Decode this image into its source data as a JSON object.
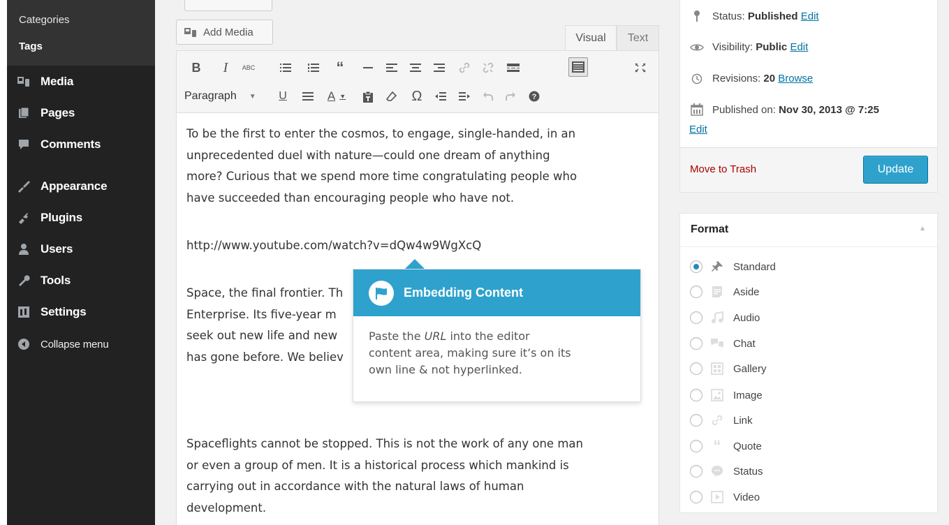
{
  "sidebar": {
    "submenu": [
      "Categories",
      "Tags"
    ],
    "items": [
      {
        "label": "Media",
        "icon": "media-icon"
      },
      {
        "label": "Pages",
        "icon": "pages-icon"
      },
      {
        "label": "Comments",
        "icon": "comments-icon"
      },
      {
        "label": "Appearance",
        "icon": "appearance-icon"
      },
      {
        "label": "Plugins",
        "icon": "plugins-icon"
      },
      {
        "label": "Users",
        "icon": "users-icon"
      },
      {
        "label": "Tools",
        "icon": "tools-icon"
      },
      {
        "label": "Settings",
        "icon": "settings-icon"
      },
      {
        "label": "Collapse menu",
        "icon": "collapse-icon"
      }
    ]
  },
  "editor": {
    "add_media_label": "Add Media",
    "tabs": {
      "visual": "Visual",
      "text": "Text"
    },
    "format_select_value": "Paragraph",
    "paragraphs": [
      [
        "To be the first to enter the cosmos, to engage, single-handed, in an",
        "unprecedented duel with nature—could one dream of anything",
        "more? Curious that we spend more time congratulating people who",
        "have succeeded than encouraging people who have not."
      ],
      [
        "http://www.youtube.com/watch?v=dQw4w9WgXcQ"
      ],
      [
        "Space, the final frontier. Th",
        "Enterprise. Its five-year m",
        "seek out new life and new",
        "has gone before. We believ"
      ],
      [
        "Spaceflights cannot be stopped. This is not the work of any one man",
        "or even a group of men. It is a historical process which mankind is",
        "carrying out in accordance with the natural laws of human",
        "development."
      ]
    ]
  },
  "pointer": {
    "title": "Embedding Content",
    "body_pre": "Paste the ",
    "body_em": "URL",
    "body_post_1": " into the editor",
    "body_line2": "content area, making sure it’s on its",
    "body_line3": "own line & not hyperlinked."
  },
  "publish": {
    "status_label": "Status:",
    "status_value": "Published",
    "status_edit": "Edit",
    "visibility_label": "Visibility:",
    "visibility_value": "Public",
    "visibility_edit": "Edit",
    "revisions_label": "Revisions:",
    "revisions_value": "20",
    "revisions_link": "Browse",
    "published_label": "Published on:",
    "published_value": "Nov 30, 2013 @ 7:25",
    "published_edit": "Edit",
    "trash_label": "Move to Trash",
    "update_label": "Update"
  },
  "format_box": {
    "title": "Format",
    "options": [
      {
        "label": "Standard",
        "icon": "pin-icon",
        "selected": true
      },
      {
        "label": "Aside",
        "icon": "aside-icon",
        "selected": false
      },
      {
        "label": "Audio",
        "icon": "audio-icon",
        "selected": false
      },
      {
        "label": "Chat",
        "icon": "chat-icon",
        "selected": false
      },
      {
        "label": "Gallery",
        "icon": "gallery-icon",
        "selected": false
      },
      {
        "label": "Image",
        "icon": "image-icon",
        "selected": false
      },
      {
        "label": "Link",
        "icon": "link-icon",
        "selected": false
      },
      {
        "label": "Quote",
        "icon": "quote-icon",
        "selected": false
      },
      {
        "label": "Status",
        "icon": "status-icon",
        "selected": false
      },
      {
        "label": "Video",
        "icon": "video-icon",
        "selected": false
      }
    ]
  },
  "colors": {
    "accent": "#2ea2cc",
    "sidebar_bg": "#222222",
    "trash": "#aa0000",
    "link": "#0074a2"
  }
}
